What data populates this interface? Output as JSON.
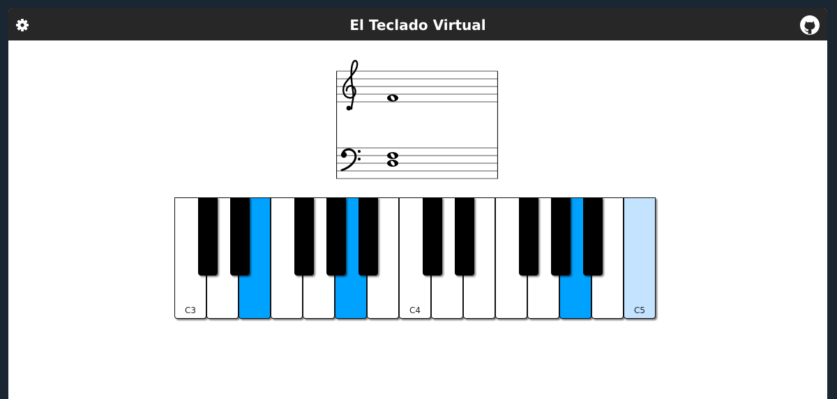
{
  "header": {
    "title": "El Teclado Virtual",
    "settings_icon": "gear-icon",
    "github_icon": "github-icon"
  },
  "colors": {
    "header_bg": "#272727",
    "active_key": "#00a2ff",
    "root_key": "#c4e3ff",
    "page_bg": "#1b2633"
  },
  "score": {
    "clefs": [
      "treble-clef",
      "bass-clef"
    ],
    "notes": [
      {
        "clef": "treble",
        "pitch": "C5",
        "shape": "whole"
      },
      {
        "clef": "bass",
        "pitch": "D3",
        "shape": "whole"
      },
      {
        "clef": "bass",
        "pitch": "B2",
        "shape": "whole"
      }
    ]
  },
  "keyboard": {
    "white_keys": [
      {
        "note": "C3",
        "label": "C3",
        "state": "normal"
      },
      {
        "note": "D3",
        "label": "",
        "state": "normal"
      },
      {
        "note": "E3",
        "label": "",
        "state": "active"
      },
      {
        "note": "F3",
        "label": "",
        "state": "normal"
      },
      {
        "note": "G3",
        "label": "",
        "state": "normal"
      },
      {
        "note": "A3",
        "label": "",
        "state": "active"
      },
      {
        "note": "B3",
        "label": "",
        "state": "normal"
      },
      {
        "note": "C4",
        "label": "C4",
        "state": "normal"
      },
      {
        "note": "D4",
        "label": "",
        "state": "normal"
      },
      {
        "note": "E4",
        "label": "",
        "state": "normal"
      },
      {
        "note": "F4",
        "label": "",
        "state": "normal"
      },
      {
        "note": "G4",
        "label": "",
        "state": "normal"
      },
      {
        "note": "A4",
        "label": "",
        "state": "active"
      },
      {
        "note": "B4",
        "label": "",
        "state": "normal"
      },
      {
        "note": "C5",
        "label": "C5",
        "state": "root"
      }
    ],
    "black_keys": [
      {
        "note": "C#3",
        "after_white": 0
      },
      {
        "note": "D#3",
        "after_white": 1
      },
      {
        "note": "F#3",
        "after_white": 3
      },
      {
        "note": "G#3",
        "after_white": 4
      },
      {
        "note": "A#3",
        "after_white": 5
      },
      {
        "note": "C#4",
        "after_white": 7
      },
      {
        "note": "D#4",
        "after_white": 8
      },
      {
        "note": "F#4",
        "after_white": 10
      },
      {
        "note": "G#4",
        "after_white": 11
      },
      {
        "note": "A#4",
        "after_white": 12
      }
    ]
  }
}
